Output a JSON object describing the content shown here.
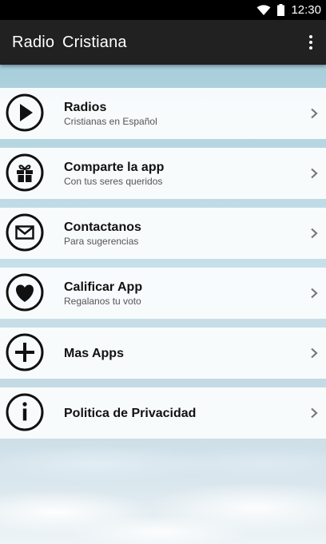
{
  "status_bar": {
    "time": "12:30",
    "wifi_icon": "wifi-icon",
    "battery_icon": "battery-icon"
  },
  "app_bar": {
    "title": "Radio  Cristiana",
    "menu_icon": "overflow-menu-icon"
  },
  "menu": [
    {
      "title": "Radios",
      "subtitle": "Cristianas en Español",
      "icon": "play-icon"
    },
    {
      "title": "Comparte la app",
      "subtitle": "Con tus seres queridos",
      "icon": "gift-icon"
    },
    {
      "title": "Contactanos",
      "subtitle": "Para sugerencias",
      "icon": "mail-icon"
    },
    {
      "title": "Calificar App",
      "subtitle": "Regalanos tu voto",
      "icon": "heart-icon"
    },
    {
      "title": "Mas Apps",
      "subtitle": "",
      "icon": "plus-icon"
    },
    {
      "title": "Politica de Privacidad",
      "subtitle": "",
      "icon": "info-icon"
    }
  ],
  "colors": {
    "app_bar": "#212121",
    "status_bar": "#000000",
    "icon_stroke": "#111111"
  }
}
